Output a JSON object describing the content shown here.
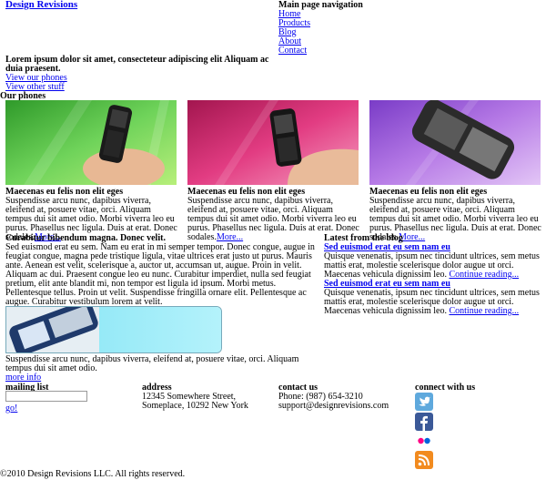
{
  "header": {
    "logo": "Design Revisions",
    "nav_title": "Main page navigation",
    "nav": [
      "Home",
      "Products",
      "Blog",
      "About",
      "Contact"
    ]
  },
  "intro": {
    "text": "Lorem ipsum dolor sit amet, consecteteur adipiscing elit Aliquam ac duia praesent.",
    "links": [
      "View our phones",
      "View other stuff"
    ]
  },
  "phones_heading": "Our phones",
  "phones": [
    {
      "title": "Maecenas eu felis non elit eges",
      "desc": "Suspendisse arcu nunc, dapibus viverra, eleifend at, posuere vitae, orci. Aliquam tempus dui sit amet odio. Morbi viverra leo eu purus. Phasellus nec ligula. Duis at erat. Donec sodales.",
      "more": "More..."
    },
    {
      "title": "Maecenas eu felis non elit eges",
      "desc": "Suspendisse arcu nunc, dapibus viverra, eleifend at, posuere vitae, orci. Aliquam tempus dui sit amet odio. Morbi viverra leo eu purus. Phasellus nec ligula. Duis at erat. Donec sodales.",
      "more": "More..."
    },
    {
      "title": "Maecenas eu felis non elit eges",
      "desc": "Suspendisse arcu nunc, dapibus viverra, eleifend at, posuere vitae, orci. Aliquam tempus dui sit amet odio. Morbi viverra leo eu purus. Phasellus nec ligula. Duis at erat. Donec sodales.",
      "more": "More..."
    }
  ],
  "feature": {
    "title": "Curabitur bibendum magna. Donec velit.",
    "text": "Sed euismod erat eu sem. Nam eu erat in mi semper tempor. Donec congue, augue in feugiat congue, magna pede tristique ligula, vitae ultrices erat justo ut purus. Mauris ante. Aenean est velit, scelerisque a, auctor ut, accumsan ut, augue. Proin in velit. Aliquam ac dui. Praesent congue leo eu nunc. Curabitur imperdiet, nulla sed feugiat pretium, elit ante blandit mi, non tempor est ligula id ipsum. Morbi metus. Pellentesque tellus. Proin ut velit. Suspendisse fringilla ornare elit. Pellentesque ac augue. Curabitur vestibulum lorem at velit.",
    "caption": "Suspendisse arcu nunc, dapibus viverra, eleifend at, posuere vitae, orci. Aliquam tempus dui sit amet odio.",
    "more": "more info"
  },
  "blog": {
    "title": "Latest from the blog",
    "posts": [
      {
        "title": "Sed euismod erat eu sem nam eu",
        "body": "Quisque venenatis, ipsum nec tincidunt ultrices, sem metus mattis erat, molestie scelerisque dolor augue ut orci. Maecenas vehicula dignissim leo.",
        "link": "Continue reading..."
      },
      {
        "title": "Sed euismod erat eu sem nam eu",
        "body": "Quisque venenatis, ipsum nec tincidunt ultrices, sem metus mattis erat, molestie scelerisque dolor augue ut orci. Maecenas vehicula dignissim leo.",
        "link": "Continue reading..."
      }
    ]
  },
  "footer": {
    "mailing_title": "mailing list",
    "mailing_value": "",
    "go": "go!",
    "address_title": "address",
    "address_line1": "12345 Somewhere Street,",
    "address_line2": "Someplace, 10292 New York",
    "contact_title": "contact us",
    "phone": "Phone: (987) 654-3210",
    "email": "support@designrevisions.com",
    "connect_title": "connect with us",
    "social": [
      {
        "icon": "twitter-icon",
        "color": "#5fa9dd"
      },
      {
        "icon": "facebook-icon",
        "color": "#3b5998"
      },
      {
        "icon": "flickr-icon",
        "color": "#2b2b2b"
      },
      {
        "icon": "rss-icon",
        "color": "#f28b1f"
      }
    ],
    "copyright": "©2010 Design Revisions LLC. All rights reserved."
  }
}
